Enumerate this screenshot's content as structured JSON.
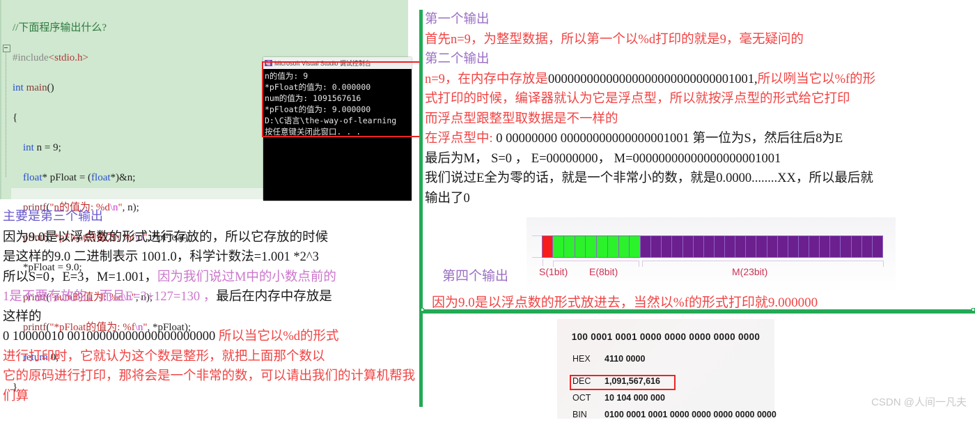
{
  "code_editor": {
    "lines": [
      {
        "id": "l1",
        "text": "//下面程序输出什么?"
      },
      {
        "id": "l2",
        "text": "#include<stdio.h>"
      },
      {
        "id": "l3",
        "text": "int main()"
      },
      {
        "id": "l4",
        "text": "{"
      },
      {
        "id": "l5",
        "text": "    int n = 9;"
      },
      {
        "id": "l6",
        "text": "    float* pFloat = (float*)&n;"
      },
      {
        "id": "l7",
        "text": "    printf(\"n的值为: %d\\n\", n);"
      },
      {
        "id": "l8",
        "text": "    printf(\"*pFloat的值为: %f\\n\", *pFloat);"
      },
      {
        "id": "l9",
        "text": "    *pFloat = 9.0;"
      },
      {
        "id": "l10",
        "text": "    printf(\"num的值为: %d\\n\", n);"
      },
      {
        "id": "l11",
        "text": "    printf(\"*pFloat的值为: %f\\n\", *pFloat);"
      },
      {
        "id": "l12",
        "text": "    return 0;"
      },
      {
        "id": "l13",
        "text": "}"
      }
    ]
  },
  "console": {
    "title": "Microsoft Visual Studio 调试控制台",
    "output_lines": [
      "n的值为: 9",
      "*pFloat的值为: 0.000000",
      "num的值为: 1091567616",
      "*pFloat的值为: 9.000000"
    ],
    "trailer_lines": [
      "D:\\C语言\\the-way-of-learning",
      "按任意键关闭此窗口. . ."
    ]
  },
  "left_notes": {
    "heading": "主要是第三个输出",
    "line1": "因为9.0是以浮点数的形式进行存放的，所以它存放的时候",
    "line2": "是这样的9.0 二进制表示 1001.0，科学计数法=1.001 *2^3",
    "line3_a": "所以S=0，E=3，M=1.001，",
    "line3_b": "因为我们说过M中的小数点前的",
    "line4_a": "1是不要存放的，而且E=3+127=130 ，",
    "line4_b": "最后在内存中存放是",
    "line5": "这样的",
    "binary": "0 10000010  00100000000000000000000",
    "line6_red": "所以当它以%d的形式",
    "line7_red": "进行打印时，它就认为这个数是整形，就把上面那个数以",
    "line8_red": "它的原码进行打印，那将会是一个非常的数，可以请出我们的计算机帮我们算"
  },
  "right_notes": {
    "h1": "第一个输出",
    "p1": "首先n=9，为整型数据，所以第一个以%d打印的就是9，毫无疑问的",
    "h2": "第二个输出",
    "p2_a": "n=9，在内存中存放是",
    "p2_bin": "00000000000000000000000000001001,",
    "p2_b": "所以咧当它以%f的形",
    "p3": "式打印的时候，编译器就认为它是浮点型，所以就按浮点型的形式给它打印",
    "p4": "而浮点型跟整型取数据是不一样的",
    "p5_a": "在浮点型中:",
    "p5_b": " 0  00000000 00000000000000001001  第一位为S，然后往后8为E",
    "p6": "最后为M，    S=0 ，  E=00000000，  M=00000000000000000001001",
    "p7": "我们说过E全为零的话，就是一个非常小的数，就是0.0000........XX，所以最后就",
    "p8": "输出了0",
    "h4": "第四个输出",
    "p9": "因为9.0是以浮点数的形式放进去，当然以%f的形式打印就9.000000"
  },
  "float_diagram": {
    "s_label": "S(1bit)",
    "e_label": "E(8bit)",
    "m_label": "M(23bit)",
    "s_color": "#f81c1c",
    "e_color": "#2bf22b",
    "m_color": "#6c1f8e"
  },
  "calculator": {
    "bits_display": "100 0001 0001 0000 0000 0000 0000 0000",
    "rows": [
      {
        "label": "HEX",
        "value": "4110 0000"
      },
      {
        "label": "DEC",
        "value": "1,091,567,616"
      },
      {
        "label": "OCT",
        "value": "10 104 000 000"
      },
      {
        "label": "BIN",
        "value": "0100 0001 0001 0000 0000 0000 0000 0000"
      }
    ]
  },
  "watermark": "CSDN @人间一凡夫"
}
